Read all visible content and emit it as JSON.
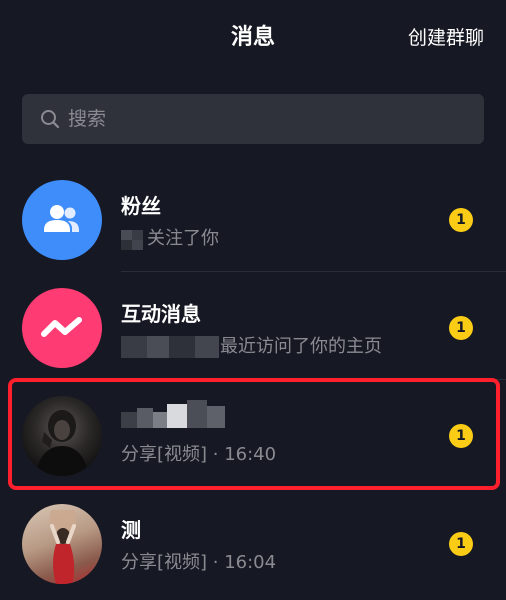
{
  "header": {
    "title": "消息",
    "create_group_label": "创建群聊"
  },
  "search": {
    "placeholder": "搜索",
    "icon": "search-icon"
  },
  "conversations": [
    {
      "name": "粉丝",
      "preview": "关注了你",
      "unread": "1",
      "avatar_icon": "fans-icon",
      "avatar_color": "#3e8dfb"
    },
    {
      "name": "互动消息",
      "preview": "最近访问了你的主页",
      "unread": "1",
      "avatar_icon": "interaction-icon",
      "avatar_color": "#fe3c73"
    },
    {
      "name": "",
      "preview": "分享[视频] · 16:40",
      "unread": "1",
      "avatar_icon": "user-avatar"
    },
    {
      "name": "测",
      "preview": "分享[视频] · 16:04",
      "unread": "1",
      "avatar_icon": "user-avatar"
    }
  ],
  "colors": {
    "background": "#161823",
    "search_bg": "#2f313b",
    "badge": "#facc15",
    "highlight": "#ff1f2d",
    "secondary_text": "#8a8b91"
  }
}
